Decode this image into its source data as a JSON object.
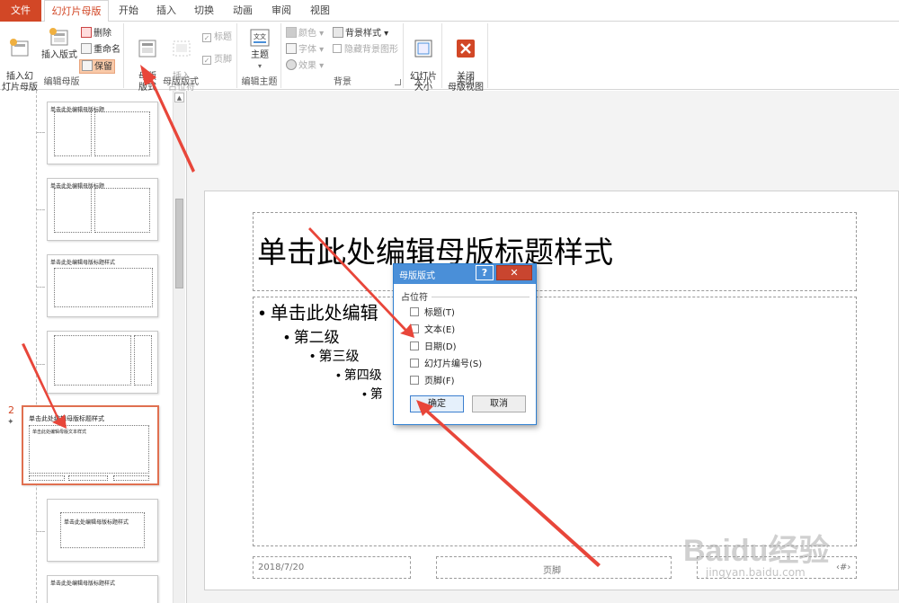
{
  "tabs": [
    {
      "label": "文件"
    },
    {
      "label": "幻灯片母版"
    },
    {
      "label": "开始"
    },
    {
      "label": "插入"
    },
    {
      "label": "切换"
    },
    {
      "label": "动画"
    },
    {
      "label": "审阅"
    },
    {
      "label": "视图"
    }
  ],
  "ribbon": {
    "edit_master": {
      "insert_slide_master": "插入幻\n灯片母版",
      "insert_layout": "插入版式",
      "delete": "删除",
      "rename": "重命名",
      "preserve": "保留",
      "group_label": "编辑母版"
    },
    "master_layout": {
      "master_layout_btn": "母版\n版式",
      "insert_placeholder": "插入\n占位符",
      "title_cb": "标题",
      "footer_cb": "页脚",
      "group_label": "母版版式"
    },
    "edit_theme": {
      "themes": "主题",
      "group_label": "编辑主题"
    },
    "background": {
      "colors": "颜色",
      "fonts": "字体",
      "effects": "效果",
      "background_styles": "背景样式",
      "hide_bg_graphics": "隐藏背景图形",
      "group_label": "背景"
    },
    "size": {
      "slide_size": "幻灯片\n大小",
      "group_label": "大小"
    },
    "close": {
      "close_master_view": "关闭\n母版视图",
      "group_label": "关闭"
    }
  },
  "thumbnails": [
    {
      "title": "单击此处编辑母版标题"
    },
    {
      "title": "单击此处编辑母版标题"
    },
    {
      "title": "单击此处编辑母版标题样式"
    },
    {
      "title": ""
    },
    {
      "title": "单击此处编辑母版标题样式",
      "sub": "单击此处编辑母版文本样式"
    },
    {
      "title": "单击此处编辑母版标题样式"
    },
    {
      "title": "单击此处编辑母版标题样式"
    }
  ],
  "selected_slide_number": "2",
  "slide": {
    "title": "单击此处编辑母版标题样式",
    "levels": [
      "单击此处编辑",
      "第二级",
      "第三级",
      "第四级",
      "第"
    ],
    "bullet": "•",
    "date": "2018/7/20",
    "footer": "页脚",
    "page_num": "‹#›"
  },
  "dialog": {
    "title": "母版版式",
    "help": "?",
    "close": "✕",
    "group": "占位符",
    "items": [
      "标题(T)",
      "文本(E)",
      "日期(D)",
      "幻灯片编号(S)",
      "页脚(F)"
    ],
    "ok": "确定",
    "cancel": "取消"
  },
  "watermark": {
    "brand": "Baidu经验",
    "url": "jingyan.baidu.com"
  },
  "colors": {
    "accent": "#d24726",
    "dialog_title": "#4a8fd8",
    "arrow": "#e8463a"
  }
}
